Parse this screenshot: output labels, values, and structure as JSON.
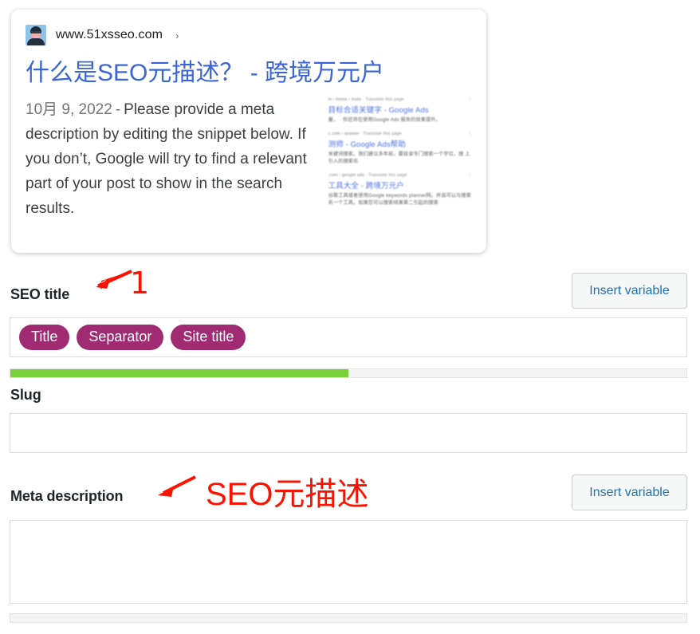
{
  "preview": {
    "favicon_name": "site-avatar-favicon",
    "url": "www.51xsseo.com",
    "url_caret": "›",
    "title": "什么是SEO元描述？ - 跨境万元户",
    "date": "10月 9, 2022",
    "date_separator": "-",
    "description": "Please provide a meta description by editing the snippet below. If you don’t, Google will try to find a relevant part of your post to show in the search results.",
    "thumbnail": {
      "alt": "blurred google search results screenshot",
      "results": [
        {
          "crumb": "m › home › tools",
          "translate": "Translate this page",
          "menu": "⋮",
          "heading": "目标合适关键字 - Google Ads",
          "snippet": "量， · 你还将在使用Google Ads 报告的效果提升。"
        },
        {
          "crumb": "c.com › answer",
          "translate": "Translate this page",
          "menu": "⋮",
          "heading": "测师 - Google Ads帮助",
          "snippet": "关键词搜索。我们建议多年前，要目录专门搜索一个学位，搜 上引入的搜索名"
        },
        {
          "crumb": ".com › google ads",
          "translate": "Translate this page",
          "menu": "⋮",
          "heading": "工具大全 - 跨境万元户",
          "snippet": "谷歌工具或者使用Google keywords planner网。并且可以与搜索名一个工具。如果您可以搜索结果第二引起的搜索"
        }
      ]
    }
  },
  "seo_title": {
    "label": "SEO title",
    "insert_variable": "Insert variable",
    "pills": [
      "Title",
      "Separator",
      "Site title"
    ],
    "progress_percent": 50,
    "progress_color": "#7ad03a"
  },
  "slug": {
    "label": "Slug",
    "value": "",
    "placeholder": ""
  },
  "meta_description": {
    "label": "Meta description",
    "insert_variable": "Insert variable",
    "value": "",
    "placeholder": "",
    "progress_percent": 0
  },
  "annotations": {
    "marker_one": "1",
    "marker_meta": "SEO元描述",
    "color": "#fb1200",
    "arrow_one_name": "red-arrow-icon",
    "arrow_meta_name": "red-arrow-icon"
  }
}
